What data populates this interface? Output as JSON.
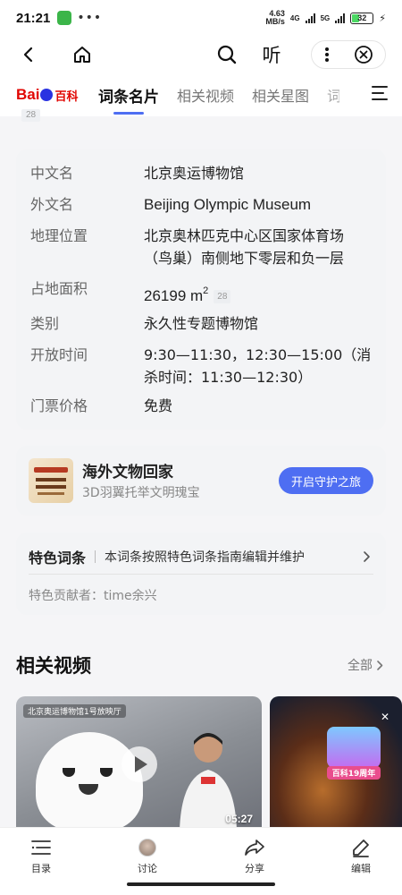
{
  "status": {
    "time": "21:21",
    "net_speed_value": "4.63",
    "net_speed_unit": "MB/s",
    "gen1": "4G",
    "gen2": "5G",
    "battery": "32",
    "battery_level": 0.32
  },
  "nav": {
    "listen_label": "听"
  },
  "tabs": {
    "logo_bai": "Bai",
    "logo_du": "du",
    "logo_baike": "百科",
    "items": [
      "词条名片",
      "相关视频",
      "相关星图",
      "词"
    ],
    "top_ref": "28"
  },
  "info": {
    "rows": [
      {
        "key": "中文名",
        "value": "北京奥运博物馆"
      },
      {
        "key": "外文名",
        "value": "Beijing Olympic Museum"
      },
      {
        "key": "地理位置",
        "value": "北京奥林匹克中心区国家体育场（鸟巢）南侧地下零层和负一层"
      },
      {
        "key": "占地面积",
        "value": "26199 m",
        "sup": "2",
        "ref": "28"
      },
      {
        "key": "类别",
        "value": "永久性专题博物馆"
      },
      {
        "key": "开放时间",
        "value": "9:30—11:30，12:30—15:00（消杀时间：11:30—12:30）"
      },
      {
        "key": "门票价格",
        "value": "免费"
      }
    ]
  },
  "promo": {
    "title": "海外文物回家",
    "subtitle": "3D羽翼托举文明瑰宝",
    "button": "开启守护之旅"
  },
  "feature": {
    "title": "特色词条",
    "desc": "本词条按照特色词条指南编辑并维护",
    "contributor": "特色贡献者：time余兴"
  },
  "videos": {
    "section_title": "相关视频",
    "all_label": "全部",
    "items": [
      {
        "caption": "北京奥运博物馆1号放映厅",
        "duration": "05:27"
      },
      {
        "badge": "百科19周年"
      }
    ]
  },
  "bottom": {
    "toc": "目录",
    "discuss": "讨论",
    "share": "分享",
    "edit": "编辑"
  }
}
